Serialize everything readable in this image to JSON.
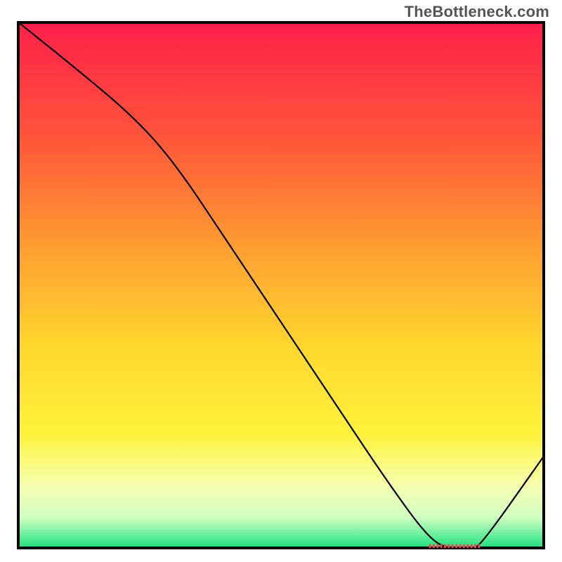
{
  "watermark": "TheBottleneck.com",
  "chart_data": {
    "type": "line",
    "title": "",
    "xlabel": "",
    "ylabel": "",
    "xlim": [
      0,
      100
    ],
    "ylim": [
      0,
      100
    ],
    "grid": false,
    "legend": false,
    "series": [
      {
        "name": "curve",
        "x": [
          0,
          10,
          22,
          30,
          40,
          50,
          60,
          70,
          78,
          82,
          86,
          88,
          100
        ],
        "values": [
          100,
          92,
          82,
          73,
          58,
          43,
          28,
          13,
          2,
          0,
          0,
          1,
          18
        ]
      }
    ],
    "marker_band": {
      "name": "optimum-range",
      "x_start": 78,
      "x_end": 88,
      "y": 0.6
    },
    "gradient_stops": [
      {
        "offset": 0,
        "color": "#ff1f4b"
      },
      {
        "offset": 22,
        "color": "#ff553a"
      },
      {
        "offset": 45,
        "color": "#ffa531"
      },
      {
        "offset": 62,
        "color": "#ffd82e"
      },
      {
        "offset": 78,
        "color": "#fff23a"
      },
      {
        "offset": 88,
        "color": "#f6ffb0"
      },
      {
        "offset": 94,
        "color": "#cfffc2"
      },
      {
        "offset": 100,
        "color": "#15e07a"
      }
    ],
    "border_width": 4,
    "curve_width": 2.2
  }
}
